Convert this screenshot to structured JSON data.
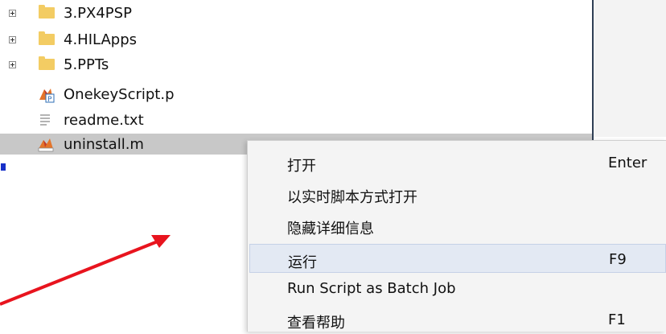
{
  "tree": {
    "items": [
      {
        "label": "3.PX4PSP",
        "type": "folder",
        "expandable": true
      },
      {
        "label": "4.HILApps",
        "type": "folder",
        "expandable": true
      },
      {
        "label": "5.PPTs",
        "type": "folder",
        "expandable": true
      },
      {
        "label": "OnekeyScript.p",
        "type": "p-file"
      },
      {
        "label": "readme.txt",
        "type": "text-file"
      },
      {
        "label": "uninstall.m",
        "type": "m-file",
        "selected": true
      }
    ]
  },
  "context_menu": {
    "items": [
      {
        "label": "打开",
        "shortcut": "Enter"
      },
      {
        "label": "以实时脚本方式打开",
        "shortcut": ""
      },
      {
        "label": "隐藏详细信息",
        "shortcut": ""
      },
      {
        "label": "运行",
        "shortcut": "F9",
        "highlighted": true
      },
      {
        "label": "Run Script as Batch Job",
        "shortcut": ""
      },
      {
        "label": "查看帮助",
        "shortcut": "F1"
      }
    ]
  },
  "annotation": {
    "arrow_color": "#e8141e",
    "selection_color": "#c8c8c8",
    "marker_color": "#1730c8"
  }
}
